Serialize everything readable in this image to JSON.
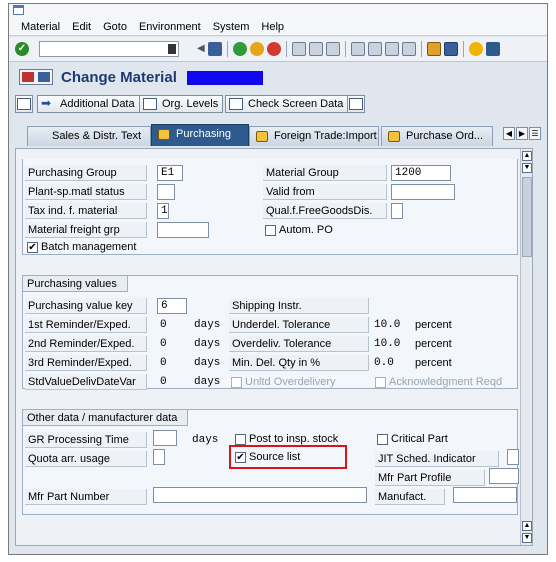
{
  "menu": [
    "Material",
    "Edit",
    "Goto",
    "Environment",
    "System",
    "Help"
  ],
  "title": "Change Material",
  "buttons": {
    "additional_data": "Additional Data",
    "org_levels": "Org. Levels",
    "check_screen": "Check Screen Data"
  },
  "tabs": [
    {
      "label": "Sales & Distr. Text",
      "active": false
    },
    {
      "label": "Purchasing",
      "active": true
    },
    {
      "label": "Foreign Trade:Import",
      "active": false
    },
    {
      "label": "Purchase Ord...",
      "active": false
    }
  ],
  "general": {
    "purchasing_group_label": "Purchasing Group",
    "purchasing_group_value": "E1",
    "plant_status_label": "Plant-sp.matl status",
    "plant_status_value": "",
    "tax_ind_label": "Tax ind. f. material",
    "tax_ind_value": "1",
    "freight_grp_label": "Material freight grp",
    "freight_grp_value": "",
    "batch_mgmt_label": "Batch management",
    "batch_mgmt_checked": true,
    "material_group_label": "Material Group",
    "material_group_value": "1200",
    "valid_from_label": "Valid from",
    "valid_from_value": "",
    "qual_free_label": "Qual.f.FreeGoodsDis.",
    "qual_free_value": "",
    "autom_po_label": "Autom. PO",
    "autom_po_checked": false
  },
  "purch_values": {
    "group_title": "Purchasing values",
    "pvk_label": "Purchasing value key",
    "pvk_value": "6",
    "rem1_label": "1st Reminder/Exped.",
    "rem1_value": "0",
    "rem2_label": "2nd Reminder/Exped.",
    "rem2_value": "0",
    "rem3_label": "3rd Reminder/Exped.",
    "rem3_value": "0",
    "stdval_label": "StdValueDelivDateVar",
    "stdval_value": "0",
    "days": "days",
    "shipping_label": "Shipping Instr.",
    "underdel_label": "Underdel. Tolerance",
    "underdel_value": "10.0",
    "overdel_label": "Overdeliv. Tolerance",
    "overdel_value": "10.0",
    "mindel_label": "Min. Del. Qty in %",
    "mindel_value": "0.0",
    "percent": "percent",
    "unltd_label": "Unltd Overdelivery",
    "ack_label": "Acknowledgment Reqd"
  },
  "other": {
    "group_title": "Other data / manufacturer data",
    "gr_time_label": "GR Processing Time",
    "gr_time_value": "",
    "days": "days",
    "quota_label": "Quota arr. usage",
    "quota_value": "",
    "post_insp_label": "Post to insp. stock",
    "post_insp_checked": false,
    "source_list_label": "Source list",
    "source_list_checked": true,
    "critical_label": "Critical Part",
    "critical_checked": false,
    "jit_label": "JIT Sched. Indicator",
    "jit_value": "",
    "mfr_profile_label": "Mfr Part Profile",
    "mfr_profile_value": "",
    "mfr_part_label": "Mfr Part Number",
    "mfr_part_value": "",
    "manufact_label": "Manufact.",
    "manufact_value": ""
  },
  "colors": {
    "highlight": "#d9141a",
    "active_tab": "#2e5a8d",
    "title": "#1d3b73"
  }
}
